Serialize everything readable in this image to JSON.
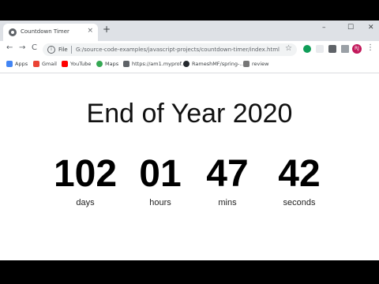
{
  "browser": {
    "tab_title": "Countdown Timer",
    "tab_close": "×",
    "new_tab": "+",
    "window_controls": {
      "minimize": "–",
      "maximize": "☐",
      "close": "✕"
    },
    "nav": {
      "back": "←",
      "forward": "→",
      "reload": "C"
    },
    "address": {
      "protocol": "File",
      "url": "G:/source-code-examples/javascript-projects/countdown-timer/index.html",
      "star": "☆"
    },
    "avatar_initials": "RJ",
    "menu": "⋮"
  },
  "bookmarks": [
    {
      "label": "Apps",
      "icon": "apps-grid-icon",
      "color": "#4285f4"
    },
    {
      "label": "Gmail",
      "icon": "gmail-icon",
      "color": "#ea4335"
    },
    {
      "label": "YouTube",
      "icon": "youtube-icon",
      "color": "#ff0000"
    },
    {
      "label": "Maps",
      "icon": "maps-icon",
      "color": "#34a853"
    },
    {
      "label": "https://am1.myprof...",
      "icon": "image-icon",
      "color": "#5f6368"
    },
    {
      "label": "RameshMF/spring-...",
      "icon": "github-icon",
      "color": "#24292e"
    },
    {
      "label": "review",
      "icon": "wikipedia-icon",
      "color": "#777777"
    }
  ],
  "page": {
    "heading": "End of Year 2020",
    "countdown": [
      {
        "value": "102",
        "label": "days"
      },
      {
        "value": "01",
        "label": "hours"
      },
      {
        "value": "47",
        "label": "mins"
      },
      {
        "value": "42",
        "label": "seconds"
      }
    ]
  }
}
